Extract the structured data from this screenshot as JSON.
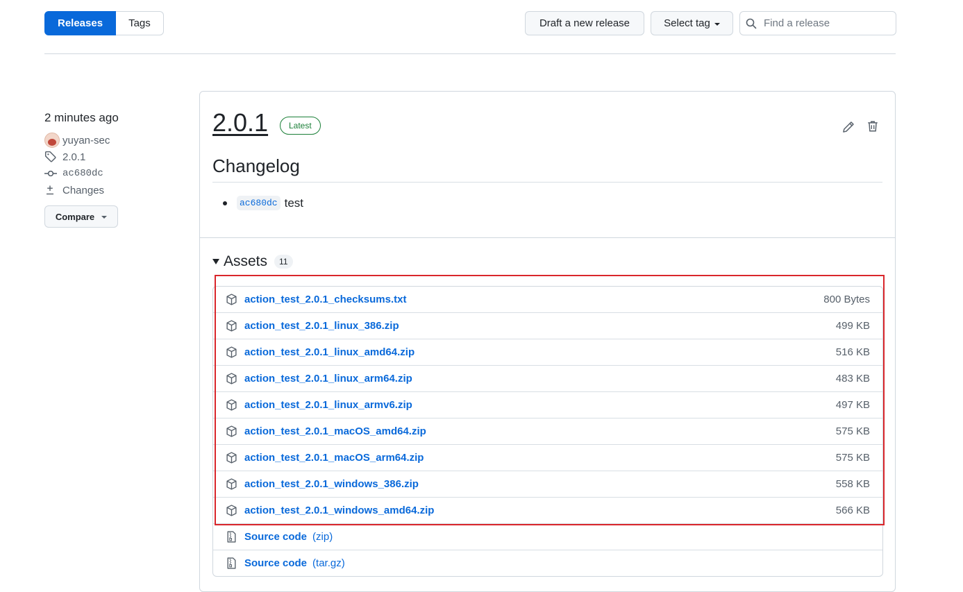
{
  "nav": {
    "tabs": [
      {
        "label": "Releases",
        "selected": true
      },
      {
        "label": "Tags",
        "selected": false
      }
    ],
    "draft_button": "Draft a new release",
    "select_tag_button": "Select tag",
    "search_placeholder": "Find a release"
  },
  "release_meta": {
    "time": "2 minutes ago",
    "author": "yuyan-sec",
    "tag": "2.0.1",
    "commit": "ac680dc",
    "changes": "Changes",
    "compare_button": "Compare"
  },
  "release": {
    "title": "2.0.1",
    "badge": "Latest",
    "changelog_heading": "Changelog",
    "changelog_items": [
      {
        "commit": "ac680dc",
        "text": "test"
      }
    ],
    "assets_label": "Assets",
    "assets_count": "11",
    "assets": [
      {
        "name": "action_test_2.0.1_checksums.txt",
        "size": "800 Bytes",
        "icon": "package-icon"
      },
      {
        "name": "action_test_2.0.1_linux_386.zip",
        "size": "499 KB",
        "icon": "package-icon"
      },
      {
        "name": "action_test_2.0.1_linux_amd64.zip",
        "size": "516 KB",
        "icon": "package-icon"
      },
      {
        "name": "action_test_2.0.1_linux_arm64.zip",
        "size": "483 KB",
        "icon": "package-icon"
      },
      {
        "name": "action_test_2.0.1_linux_armv6.zip",
        "size": "497 KB",
        "icon": "package-icon"
      },
      {
        "name": "action_test_2.0.1_macOS_amd64.zip",
        "size": "575 KB",
        "icon": "package-icon"
      },
      {
        "name": "action_test_2.0.1_macOS_arm64.zip",
        "size": "575 KB",
        "icon": "package-icon"
      },
      {
        "name": "action_test_2.0.1_windows_386.zip",
        "size": "558 KB",
        "icon": "package-icon"
      },
      {
        "name": "action_test_2.0.1_windows_amd64.zip",
        "size": "566 KB",
        "icon": "package-icon"
      }
    ],
    "source_code": [
      {
        "name": "Source code",
        "ext": "(zip)",
        "icon": "file-zip-icon"
      },
      {
        "name": "Source code",
        "ext": "(tar.gz)",
        "icon": "file-zip-icon"
      }
    ]
  },
  "colors": {
    "accent": "#0969da",
    "latest_badge": "#1a7f37",
    "highlight_box": "#d9262b"
  }
}
